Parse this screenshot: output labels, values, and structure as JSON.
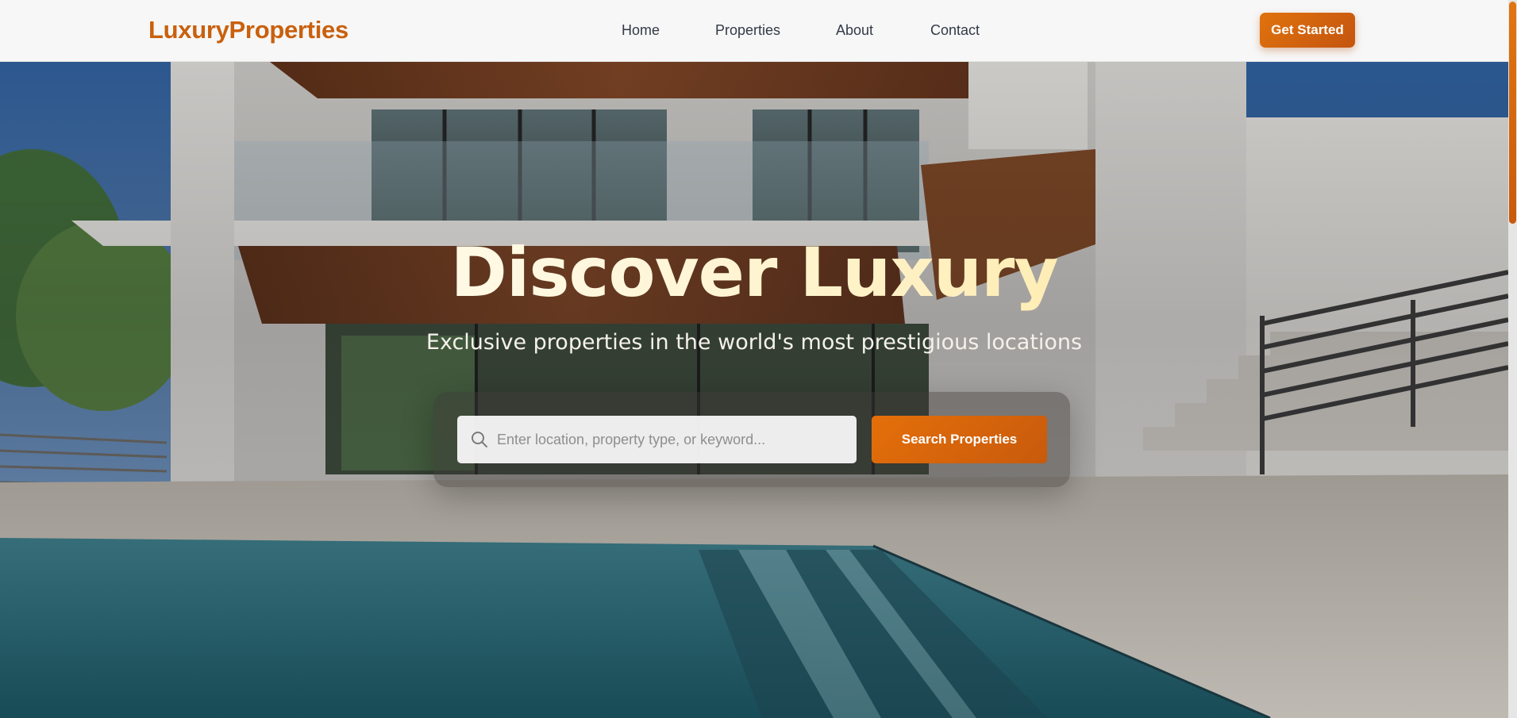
{
  "brand": {
    "name": "LuxuryProperties"
  },
  "nav": {
    "links": [
      {
        "label": "Home"
      },
      {
        "label": "Properties"
      },
      {
        "label": "About"
      },
      {
        "label": "Contact"
      }
    ],
    "cta_label": "Get Started"
  },
  "hero": {
    "title": "Discover Luxury",
    "subtitle": "Exclusive properties in the world's most prestigious locations",
    "search": {
      "placeholder": "Enter location, property type, or keyword...",
      "value": "",
      "button_label": "Search Properties"
    }
  },
  "colors": {
    "accent": "#d9660c",
    "accent_dark": "#c45510",
    "nav_background": "#f7f7f8",
    "nav_text": "#333a46",
    "title_gold": "#fde28a"
  },
  "icons": {
    "search": "search-icon"
  }
}
